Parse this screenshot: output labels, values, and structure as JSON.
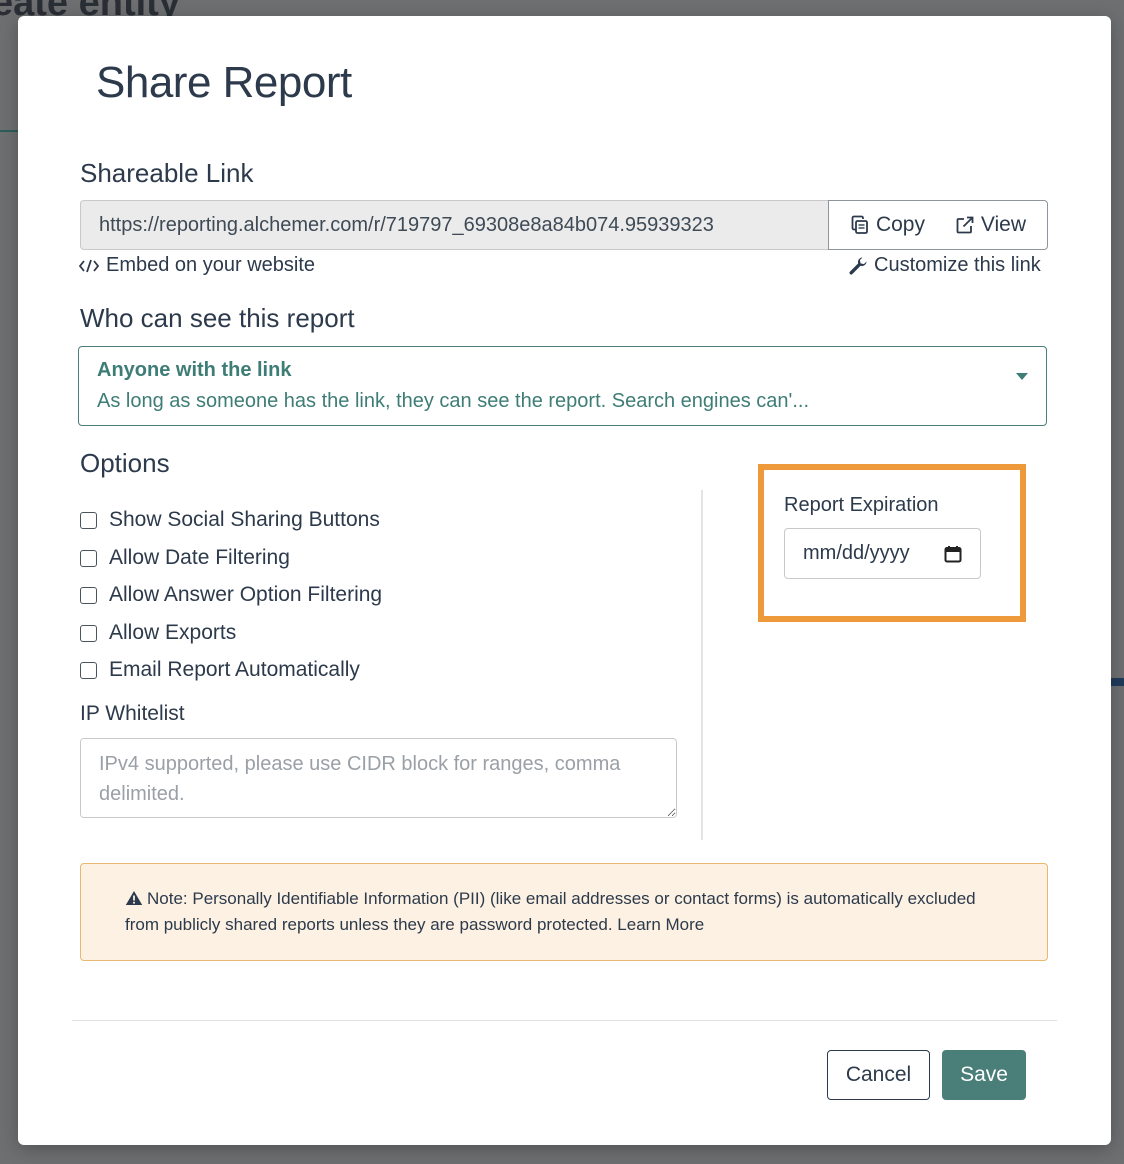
{
  "background": {
    "page_title_fragment": "eate entity"
  },
  "modal": {
    "title": "Share Report",
    "shareable_link": {
      "label": "Shareable Link",
      "url": "https://reporting.alchemer.com/r/719797_69308e8a84b074.95939323",
      "copy_label": "Copy",
      "view_label": "View",
      "embed_label": "Embed on your website",
      "customize_label": "Customize this link"
    },
    "visibility": {
      "label": "Who can see this report",
      "selected_title": "Anyone with the link",
      "selected_description": "As long as someone has the link, they can see the report. Search engines can'..."
    },
    "options": {
      "label": "Options",
      "items": [
        {
          "label": "Show Social Sharing Buttons",
          "checked": false
        },
        {
          "label": "Allow Date Filtering",
          "checked": false
        },
        {
          "label": "Allow Answer Option Filtering",
          "checked": false
        },
        {
          "label": "Allow Exports",
          "checked": false
        },
        {
          "label": "Email Report Automatically",
          "checked": false
        }
      ],
      "ip_whitelist": {
        "label": "IP Whitelist",
        "placeholder": "IPv4 supported, please use CIDR block for ranges, comma delimited."
      }
    },
    "expiration": {
      "label": "Report Expiration",
      "placeholder": "mm/dd/yyyy"
    },
    "note": {
      "text": "Note: Personally Identifiable Information (PII) (like email addresses or contact forms) is automatically excluded from publicly shared reports unless they are password protected. Learn More"
    },
    "footer": {
      "cancel_label": "Cancel",
      "save_label": "Save"
    }
  },
  "colors": {
    "accent": "#4a7f79",
    "highlight": "#ef9a3a",
    "note_bg": "#fcf1e3",
    "text": "#2c3a4b"
  }
}
